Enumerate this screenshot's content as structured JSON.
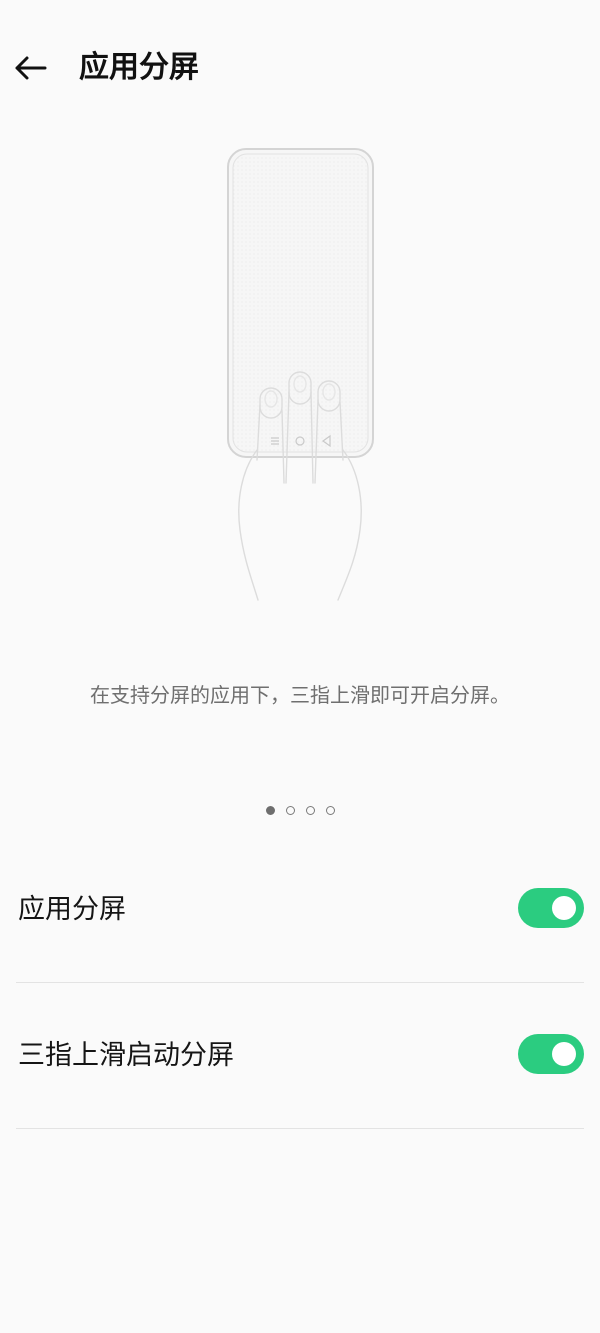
{
  "header": {
    "title": "应用分屏"
  },
  "illustration": {
    "nav_icons": [
      "menu-icon",
      "home-icon",
      "back-triangle-icon"
    ]
  },
  "caption": "在支持分屏的应用下，三指上滑即可开启分屏。",
  "pager": {
    "count": 4,
    "active_index": 0
  },
  "settings": [
    {
      "label": "应用分屏",
      "enabled": true
    },
    {
      "label": "三指上滑启动分屏",
      "enabled": true
    }
  ],
  "colors": {
    "accent": "#2bcc80",
    "background": "#fafafa",
    "caption": "#6f6f6f"
  }
}
